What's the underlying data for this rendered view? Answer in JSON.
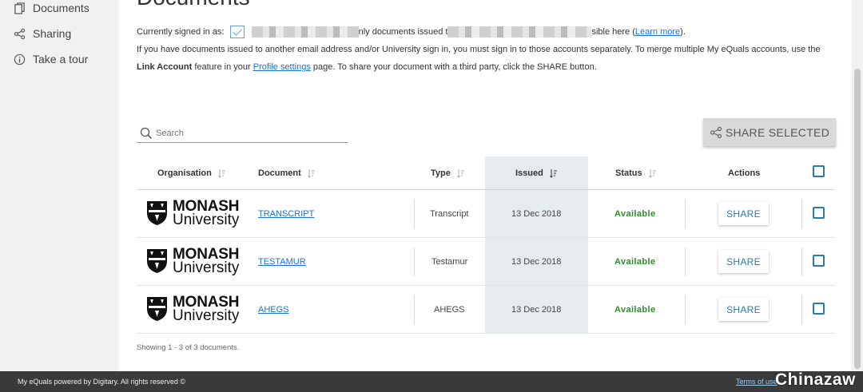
{
  "sidebar": {
    "items": [
      {
        "label": "Documents",
        "icon": "document-icon"
      },
      {
        "label": "Sharing",
        "icon": "share-icon"
      },
      {
        "label": "Take a tour",
        "icon": "info-icon"
      }
    ]
  },
  "page": {
    "title": "Documents",
    "signed_in_prefix": "Currently signed in as:",
    "signed_in_mid": "nly documents issued t",
    "signed_in_suffix": "sible here (",
    "learn_more": "Learn more",
    "learn_more_close": ").",
    "line2": "If you have documents issued to another email address and/or University sign in, you must sign in to those accounts separately. To merge multiple My eQuals accounts, use the",
    "link_account": "Link Account",
    "line3_a": " feature in your ",
    "profile_settings": "Profile settings",
    "line3_b": " page. To share your document with a third party, click the SHARE button."
  },
  "search": {
    "placeholder": "Search"
  },
  "share_selected": {
    "label": "SHARE SELECTED"
  },
  "table": {
    "headers": {
      "organisation": "Organisation",
      "document": "Document",
      "type": "Type",
      "issued": "Issued",
      "status": "Status",
      "actions": "Actions"
    },
    "rows": [
      {
        "org_line1": "MONASH",
        "org_line2": "University",
        "document": "TRANSCRIPT",
        "type": "Transcript",
        "issued": "13 Dec 2018",
        "status": "Available",
        "action": "SHARE"
      },
      {
        "org_line1": "MONASH",
        "org_line2": "University",
        "document": "TESTAMUR",
        "type": "Testamur",
        "issued": "13 Dec 2018",
        "status": "Available",
        "action": "SHARE"
      },
      {
        "org_line1": "MONASH",
        "org_line2": "University",
        "document": "AHEGS",
        "type": "AHEGS",
        "issued": "13 Dec 2018",
        "status": "Available",
        "action": "SHARE"
      }
    ]
  },
  "showing": "Showing 1 - 3 of 3 documents.",
  "footer": {
    "copyright": "My eQuals powered by Digitary. All rights reserved ©",
    "terms": "Terms of use"
  },
  "watermark": "Chinazaw",
  "colors": {
    "link": "#1a73c8",
    "status_available": "#2e8b2e",
    "accent": "#2b7bb0",
    "sorted_column_bg": "#e6ebef",
    "footer_bg": "#3a3a3a"
  }
}
